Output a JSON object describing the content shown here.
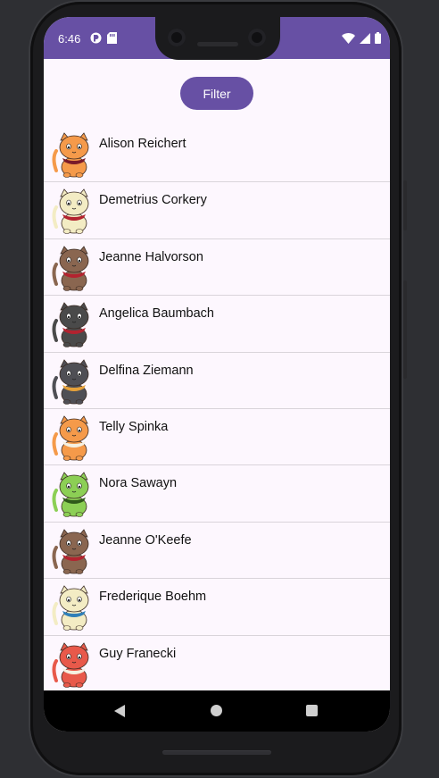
{
  "status_bar": {
    "time": "6:46",
    "icons_left": [
      "app-notification-icon",
      "sd-card-icon"
    ],
    "icons_right": [
      "wifi-icon",
      "cellular-signal-icon",
      "battery-icon"
    ],
    "color": "#6750a4"
  },
  "filter": {
    "label": "Filter"
  },
  "list": {
    "items": [
      {
        "name": "Alison Reichert",
        "avatar": "orange-cat-headphones",
        "fur": "#f59a4a",
        "accent": "#7a1a2a"
      },
      {
        "name": "Demetrius Corkery",
        "avatar": "cream-cat-red-scarf",
        "fur": "#f3ecc4",
        "accent": "#b3232f"
      },
      {
        "name": "Jeanne Halvorson",
        "avatar": "brown-cat-red-scarf",
        "fur": "#8a6650",
        "accent": "#b3232f"
      },
      {
        "name": "Angelica Baumbach",
        "avatar": "gray-cat-red-collar",
        "fur": "#4a4a4a",
        "accent": "#b3232f"
      },
      {
        "name": "Delfina Ziemann",
        "avatar": "spotted-gray-cat",
        "fur": "#4f4f55",
        "accent": "#e6a13a"
      },
      {
        "name": "Telly Spinka",
        "avatar": "orange-cat-winking",
        "fur": "#f59a4a",
        "accent": "#f5f0e0"
      },
      {
        "name": "Nora Sawayn",
        "avatar": "green-cat",
        "fur": "#8ccf55",
        "accent": "#2f5a1a"
      },
      {
        "name": "Jeanne O'Keefe",
        "avatar": "brown-cat-red-scarf",
        "fur": "#8a6650",
        "accent": "#b3232f"
      },
      {
        "name": "Frederique Boehm",
        "avatar": "cream-cat-blue-scarf",
        "fur": "#f3ecc4",
        "accent": "#2f7fb8"
      },
      {
        "name": "Guy Franecki",
        "avatar": "red-cat",
        "fur": "#e8594a",
        "accent": "#f5f0e0"
      }
    ]
  },
  "navbar": {
    "back": "back-icon",
    "home": "home-icon",
    "recents": "recents-icon"
  }
}
